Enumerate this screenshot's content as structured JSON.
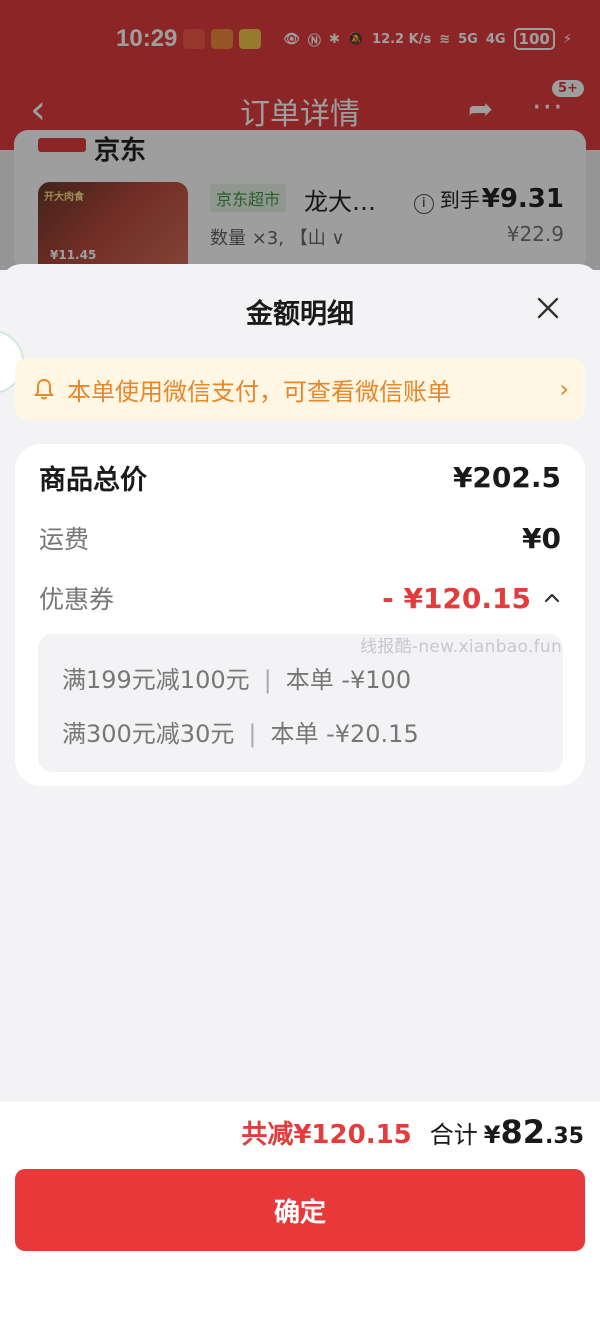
{
  "status_bar": {
    "time": "10:29",
    "network_speed": "12.2 K/s",
    "signal_5g": "5G",
    "signal_4g": "4G",
    "battery": "100"
  },
  "nav": {
    "title": "订单详情",
    "badge": "5+"
  },
  "order": {
    "store_name": "京东",
    "market_tag": "京东超市",
    "product_name": "龙大…",
    "price_label": "到手",
    "final_price": "¥9.31",
    "quantity": "数量 ×3, 【山 ∨",
    "original_price": "¥22.9",
    "thumb_text": "开大肉食",
    "thumb_price": "¥11.45"
  },
  "sheet": {
    "title": "金额明细",
    "notice": "本单使用微信支付，可查看微信账单",
    "rows": {
      "total_label": "商品总价",
      "total_value": "¥202.5",
      "shipping_label": "运费",
      "shipping_value": "¥0",
      "coupon_label": "优惠券",
      "coupon_value": "- ¥120.15"
    },
    "coupons": [
      {
        "rule": "满199元减100元",
        "detail": "本单 -¥100"
      },
      {
        "rule": "满300元减30元",
        "detail": "本单 -¥20.15"
      }
    ],
    "watermark": "线报酷-new.xianbao.fun"
  },
  "footer": {
    "discount_total": "共减¥120.15",
    "sum_label": "合计",
    "sum_yuan": "¥",
    "sum_int": "82",
    "sum_dec": ".35",
    "confirm_label": "确定"
  },
  "colors": {
    "accent": "#e8393a",
    "notice_text": "#e8862a",
    "notice_bg": "#fff6e4",
    "market_green": "#3d9a48"
  }
}
